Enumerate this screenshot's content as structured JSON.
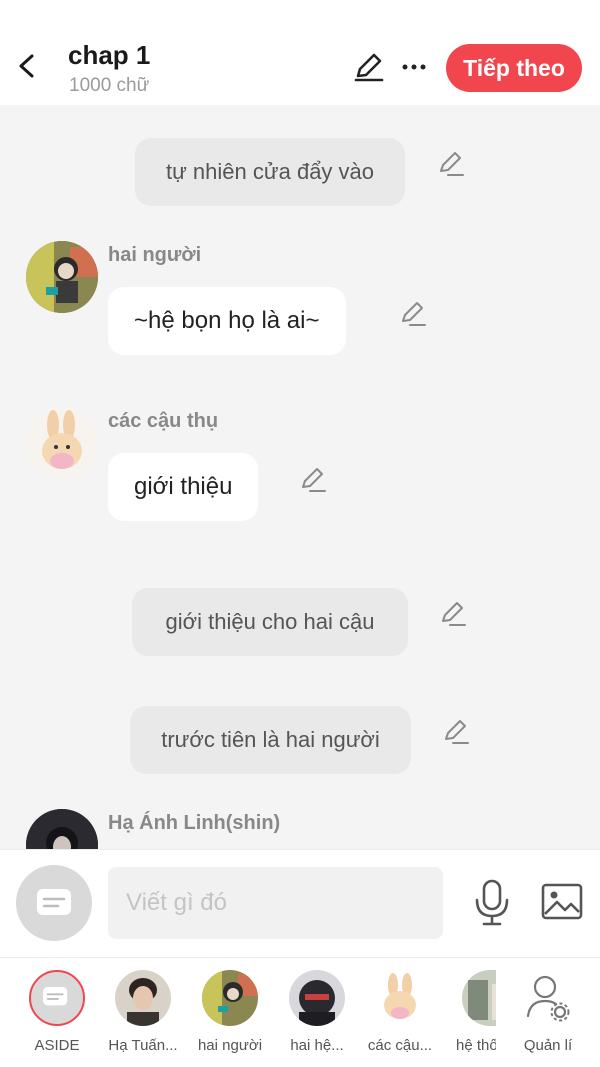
{
  "header": {
    "title": "chap 1",
    "word_count": "1000 chữ",
    "next_button": "Tiếp theo"
  },
  "messages": [
    {
      "type": "narration",
      "text": "tự nhiên cửa đẩy vào"
    },
    {
      "type": "character",
      "name": "hai người",
      "text": "~hệ bọn họ là ai~"
    },
    {
      "type": "character",
      "name": "các cậu thụ",
      "text": "giới thiệu"
    },
    {
      "type": "narration",
      "text": "giới thiệu cho hai cậu"
    },
    {
      "type": "narration",
      "text": "trước tiên là hai người"
    },
    {
      "type": "character",
      "name": "Hạ Ánh Linh(shin)",
      "text": ""
    }
  ],
  "input": {
    "placeholder": "Viết gì đó"
  },
  "characters": [
    {
      "label": "ASIDE"
    },
    {
      "label": "Hạ Tuấn..."
    },
    {
      "label": "hai người"
    },
    {
      "label": "hai hệ..."
    },
    {
      "label": "các cậu..."
    },
    {
      "label": "hệ thố"
    },
    {
      "label": "Quản lí"
    }
  ],
  "colors": {
    "accent": "#f2464e",
    "background": "#f4f4f4",
    "narration_bg": "#e9e9e9"
  }
}
